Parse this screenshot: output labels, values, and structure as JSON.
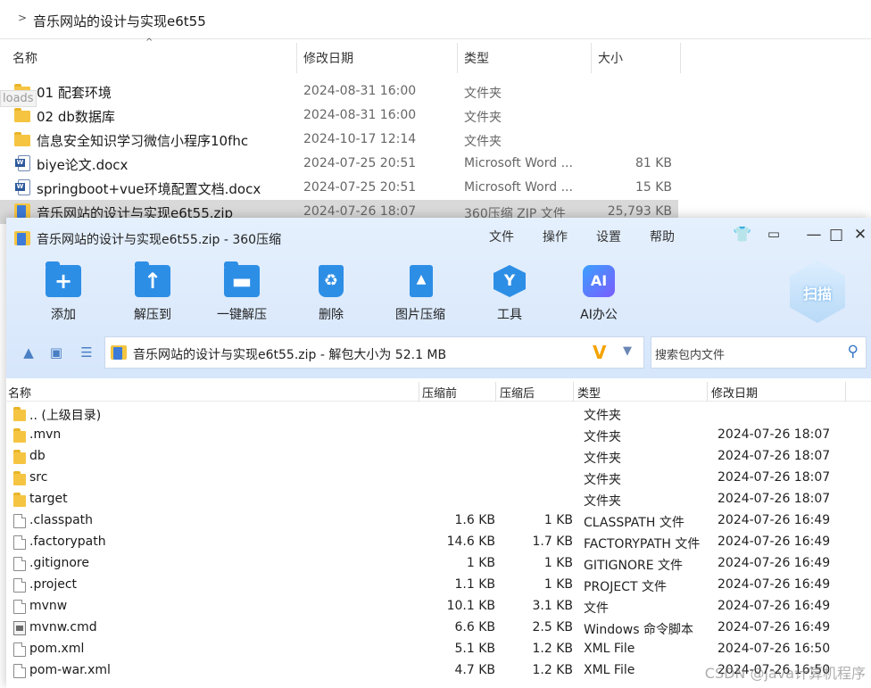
{
  "explorer": {
    "path": "音乐网站的设计与实现e6t55",
    "ghost_label": "loads",
    "columns": [
      "名称",
      "修改日期",
      "类型",
      "大小"
    ],
    "rows": [
      {
        "name": "01 配套环境",
        "date": "2024-08-31 16:00",
        "type": "文件夹",
        "size": "",
        "icon": "folder-icon"
      },
      {
        "name": "02 db数据库",
        "date": "2024-08-31 16:00",
        "type": "文件夹",
        "size": "",
        "icon": "folder-icon"
      },
      {
        "name": "信息安全知识学习微信小程序10fhc",
        "date": "2024-10-17 12:14",
        "type": "文件夹",
        "size": "",
        "icon": "folder-icon"
      },
      {
        "name": "biye论文.docx",
        "date": "2024-07-25 20:51",
        "type": "Microsoft Word ...",
        "size": "81 KB",
        "icon": "word-doc-icon"
      },
      {
        "name": "springboot+vue环境配置文档.docx",
        "date": "2024-07-25 20:51",
        "type": "Microsoft Word ...",
        "size": "15 KB",
        "icon": "word-doc-icon"
      },
      {
        "name": "音乐网站的设计与实现e6t55.zip",
        "date": "2024-07-26 18:07",
        "type": "360压缩 ZIP 文件",
        "size": "25,793 KB",
        "icon": "zip-icon"
      }
    ]
  },
  "zipwin": {
    "title": "音乐网站的设计与实现e6t55.zip - 360压缩",
    "menu": [
      "文件",
      "操作",
      "设置",
      "帮助"
    ],
    "toolbar": [
      {
        "label": "添加",
        "glyph": "+"
      },
      {
        "label": "解压到",
        "glyph": "↑"
      },
      {
        "label": "一键解压",
        "glyph": "▬"
      },
      {
        "label": "删除",
        "glyph": "♻"
      },
      {
        "label": "图片压缩",
        "glyph": "▲"
      },
      {
        "label": "工具",
        "glyph": "Y"
      },
      {
        "label": "AI办公",
        "glyph": "AI"
      }
    ],
    "scan_label": "扫描",
    "address": "音乐网站的设计与实现e6t55.zip - 解包大小为 52.1 MB",
    "address_logo": "V",
    "search_placeholder": "搜索包内文件",
    "columns": [
      "名称",
      "压缩前",
      "压缩后",
      "类型",
      "修改日期"
    ],
    "rows": [
      {
        "name": ".. (上级目录)",
        "before": "",
        "after": "",
        "type": "文件夹",
        "date": "",
        "icon": "folder-icon"
      },
      {
        "name": ".mvn",
        "before": "",
        "after": "",
        "type": "文件夹",
        "date": "2024-07-26 18:07",
        "icon": "folder-icon"
      },
      {
        "name": "db",
        "before": "",
        "after": "",
        "type": "文件夹",
        "date": "2024-07-26 18:07",
        "icon": "folder-icon"
      },
      {
        "name": "src",
        "before": "",
        "after": "",
        "type": "文件夹",
        "date": "2024-07-26 18:07",
        "icon": "folder-icon"
      },
      {
        "name": "target",
        "before": "",
        "after": "",
        "type": "文件夹",
        "date": "2024-07-26 18:07",
        "icon": "folder-icon"
      },
      {
        "name": ".classpath",
        "before": "1.6 KB",
        "after": "1 KB",
        "type": "CLASSPATH 文件",
        "date": "2024-07-26 16:49",
        "icon": "file-icon"
      },
      {
        "name": ".factorypath",
        "before": "14.6 KB",
        "after": "1.7 KB",
        "type": "FACTORYPATH 文件",
        "date": "2024-07-26 16:49",
        "icon": "file-icon"
      },
      {
        "name": ".gitignore",
        "before": "1 KB",
        "after": "1 KB",
        "type": "GITIGNORE 文件",
        "date": "2024-07-26 16:49",
        "icon": "file-icon"
      },
      {
        "name": ".project",
        "before": "1.1 KB",
        "after": "1 KB",
        "type": "PROJECT 文件",
        "date": "2024-07-26 16:49",
        "icon": "file-icon"
      },
      {
        "name": "mvnw",
        "before": "10.1 KB",
        "after": "3.1 KB",
        "type": "文件",
        "date": "2024-07-26 16:49",
        "icon": "file-icon"
      },
      {
        "name": "mvnw.cmd",
        "before": "6.6 KB",
        "after": "2.5 KB",
        "type": "Windows 命令脚本",
        "date": "2024-07-26 16:49",
        "icon": "cmd-script-icon"
      },
      {
        "name": "pom.xml",
        "before": "5.1 KB",
        "after": "1.2 KB",
        "type": "XML File",
        "date": "2024-07-26 16:50",
        "icon": "file-icon"
      },
      {
        "name": "pom-war.xml",
        "before": "4.7 KB",
        "after": "1.2 KB",
        "type": "XML File",
        "date": "2024-07-26 16:50",
        "icon": "file-icon"
      }
    ]
  },
  "watermark": "CSDN @java计算机程序",
  "colors": {
    "folder": "#f5c542",
    "accent": "#2d8ee6",
    "selected_row": "#d9d9d9",
    "window_band": "#dce9fb"
  }
}
